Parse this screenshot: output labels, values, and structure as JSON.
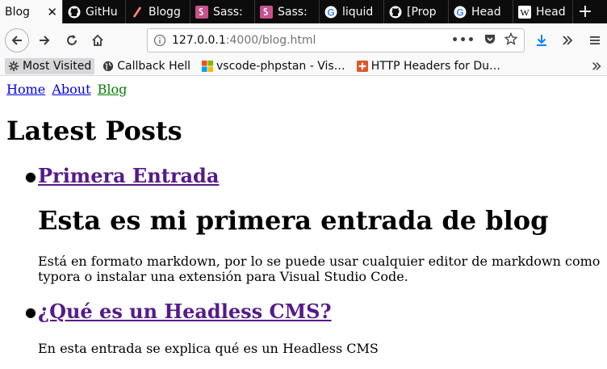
{
  "browser": {
    "tabs": [
      {
        "title": "Blog",
        "icon": "none",
        "active": true
      },
      {
        "title": "GitHu",
        "icon": "github-icon"
      },
      {
        "title": "Blogg",
        "icon": "pencil-icon"
      },
      {
        "title": "Sass:",
        "icon": "sass-icon"
      },
      {
        "title": "Sass:",
        "icon": "sass-icon"
      },
      {
        "title": "liquid",
        "icon": "google-icon"
      },
      {
        "title": "[Prop",
        "icon": "github-icon"
      },
      {
        "title": "Head",
        "icon": "google-icon"
      },
      {
        "title": "Head",
        "icon": "wikipedia-icon"
      }
    ],
    "close_glyph": "✕",
    "new_tab_glyph": "+",
    "url": {
      "host": "127.0.0.1",
      "path": ":4000/blog.html"
    },
    "bookmarks": [
      {
        "label": "Most Visited",
        "icon": "gear-icon"
      },
      {
        "label": "Callback Hell",
        "icon": "globe-icon"
      },
      {
        "label": "vscode-phpstan - Vis…",
        "icon": "windows-icon"
      },
      {
        "label": "HTTP Headers for Du…",
        "icon": "plus-box-icon"
      }
    ]
  },
  "page": {
    "nav": {
      "home": "Home",
      "about": "About",
      "blog": "Blog"
    },
    "heading": "Latest Posts",
    "posts": [
      {
        "title": "Primera Entrada",
        "h1": "Esta es mi primera entrada de blog",
        "excerpt": "Está en formato markdown, por lo se puede usar cualquier editor de markdown como typora o instalar una extensión para Visual Studio Code."
      },
      {
        "title": "¿Qué es un Headless CMS?",
        "excerpt": "En esta entrada se explica qué es un Headless CMS"
      }
    ]
  },
  "colors": {
    "tabstrip_bg": "#0c0c0d",
    "link_visited": "#551a8b",
    "link": "#0000ee",
    "link_current": "#008000"
  }
}
